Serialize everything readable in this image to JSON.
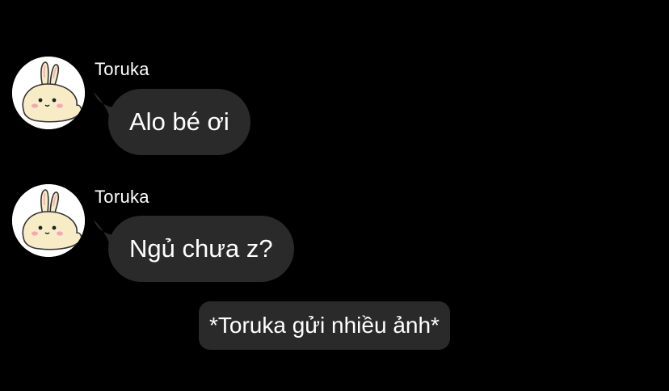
{
  "messages": [
    {
      "sender": "Toruka",
      "text": "Alo bé ơi"
    },
    {
      "sender": "Toruka",
      "text": "Ngủ chưa z?"
    }
  ],
  "system_notice": "*Toruka gửi nhiều ảnh*",
  "colors": {
    "background": "#000000",
    "bubble": "#2a2a2a",
    "text": "#ffffff",
    "avatar_background": "#ffffff"
  },
  "icons": {
    "avatar": "bunny-sticker-avatar"
  }
}
